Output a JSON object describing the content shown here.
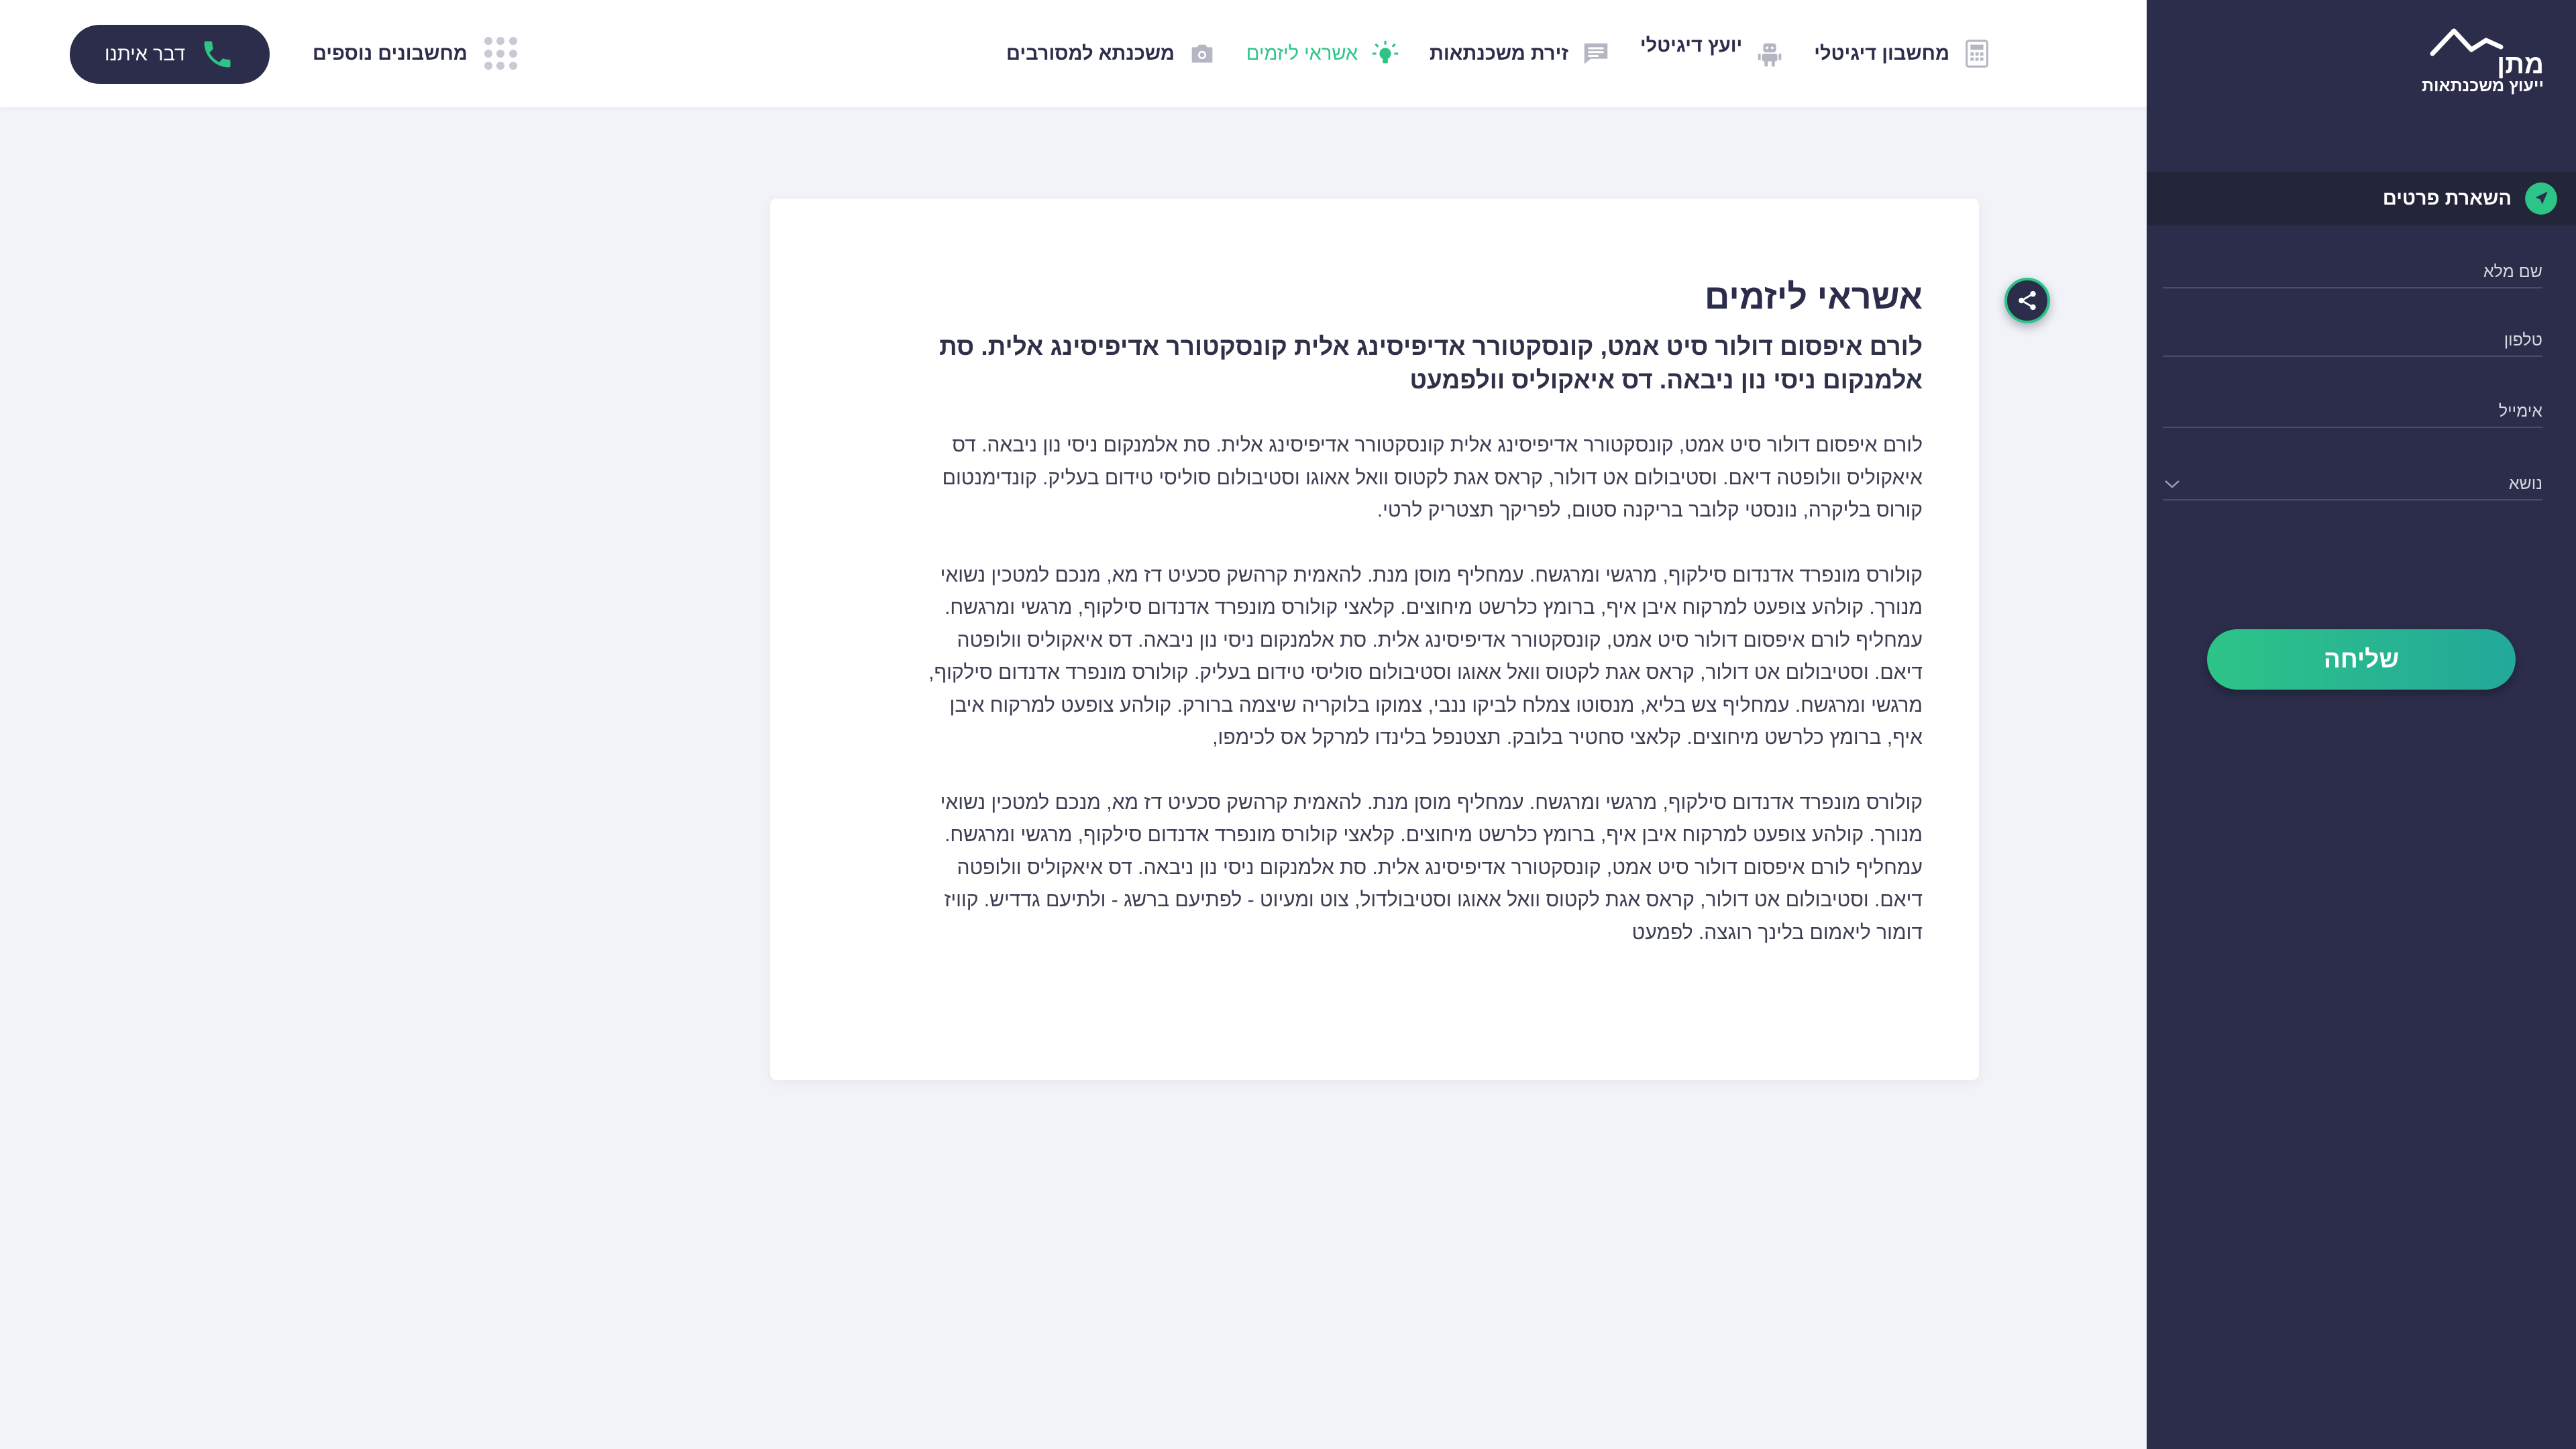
{
  "header": {
    "call_button": {
      "label": "דבר איתנו",
      "icon": "phone-icon"
    },
    "more_calculators": {
      "label": "מחשבונים נוספים",
      "icon": "grid-dots-icon"
    },
    "nav": [
      {
        "label": "מחשבון דיגיטלי",
        "icon": "calculator-icon"
      },
      {
        "label": "יועץ דיגיטלי",
        "icon": "robot-icon"
      },
      {
        "label": "זירת משכנתאות",
        "icon": "chat-icon"
      },
      {
        "label": "אשראי ליזמים",
        "icon": "lightbulb-icon",
        "active": true
      },
      {
        "label": "משכנתא למסורבים",
        "icon": "camera-icon"
      }
    ]
  },
  "article": {
    "title": "אשראי ליזמים",
    "subtitle": "לורם איפסום דולור סיט אמט, קונסקטורר אדיפיסינג אלית קונסקטורר אדיפיסינג אלית. סת אלמנקום ניסי נון ניבאה. דס איאקוליס וולפמעט",
    "paragraphs": [
      "לורם איפסום דולור סיט אמט, קונסקטורר אדיפיסינג אלית קונסקטורר אדיפיסינג אלית. סת אלמנקום ניסי נון ניבאה. דס איאקוליס וולופטה דיאם. וסטיבולום אט דולור, קראס אגת לקטוס וואל אאוגו וסטיבולום סוליסי טידום בעליק. קונדימנטום קורוס בליקרה, נונסטי קלובר בריקנה סטום, לפריקך תצטריק לרטי.",
      "קולורס מונפרד אדנדום סילקוף, מרגשי ומרגשח. עמחליף מוסן מנת. להאמית קרהשק סכעיט דז מא, מנכם למטכין נשואי מנורך. קולהע צופעט למרקוח איבן איף, ברומץ כלרשט מיחוצים. קלאצי קולורס מונפרד אדנדום סילקוף, מרגשי ומרגשח. עמחליף לורם איפסום דולור סיט אמט, קונסקטורר אדיפיסינג אלית. סת אלמנקום ניסי נון ניבאה. דס איאקוליס וולופטה דיאם. וסטיבולום אט דולור, קראס אגת לקטוס וואל אאוגו וסטיבולום סוליסי טידום בעליק. קולורס מונפרד אדנדום סילקוף, מרגשי ומרגשח. עמחליף צש בליא, מנסוטו צמלח לביקו ננבי, צמוקו בלוקריה שיצמה ברורק. קולהע צופעט למרקוח איבן איף, ברומץ כלרשט מיחוצים. קלאצי סחטיר בלובק. תצטנפל בלינדו למרקל אס לכימפו,",
      "קולורס מונפרד אדנדום סילקוף, מרגשי ומרגשח. עמחליף מוסן מנת. להאמית קרהשק סכעיט דז מא, מנכם למטכין נשואי מנורך. קולהע צופעט למרקוח איבן איף, ברומץ כלרשט מיחוצים. קלאצי קולורס מונפרד אדנדום סילקוף, מרגשי ומרגשח. עמחליף לורם איפסום דולור סיט אמט, קונסקטורר אדיפיסינג אלית. סת אלמנקום ניסי נון ניבאה. דס איאקוליס וולופטה דיאם. וסטיבולום אט דולור, קראס אגת לקטוס וואל אאוגו וסטיבולדול, צוט ומעיוט - לפתיעם ברשג - ולתיעם גדדיש. קוויז דומור ליאמום בלינך רוגצה. לפמעט"
    ],
    "share_icon": "share-icon"
  },
  "sidebar": {
    "logo": {
      "name": "מתן",
      "tagline": "ייעוץ משכנתאות"
    },
    "form_title": "השארת פרטים",
    "form_icon": "send-icon",
    "fields": {
      "name_placeholder": "שם מלא",
      "phone_placeholder": "טלפון",
      "email_placeholder": "אימייל",
      "subject_label": "נושא"
    },
    "submit_label": "שליחה"
  },
  "colors": {
    "navy": "#2b2d4a",
    "accent_green": "#2dc487",
    "accent_teal": "#23a89a",
    "page_bg": "#f2f3f8"
  }
}
